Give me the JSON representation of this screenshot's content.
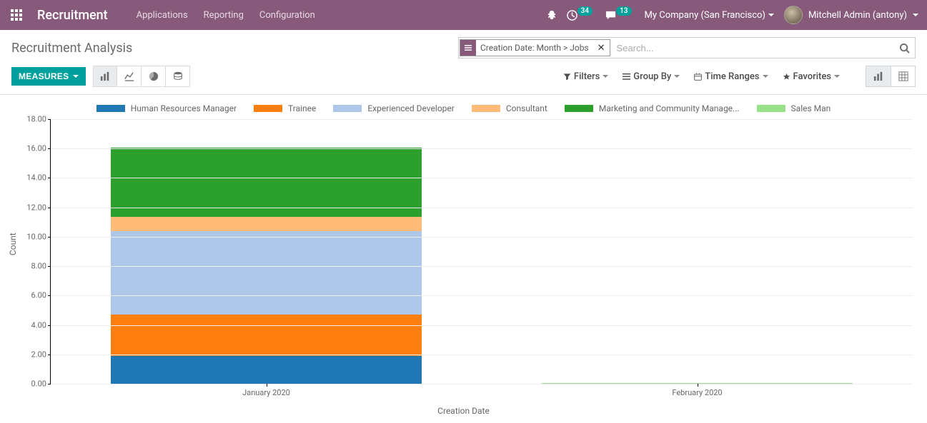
{
  "navbar": {
    "brand": "Recruitment",
    "menu": [
      "Applications",
      "Reporting",
      "Configuration"
    ],
    "activities_badge": "34",
    "messages_badge": "13",
    "company": "My Company (San Francisco)",
    "user": "Mitchell Admin (antony)"
  },
  "cp": {
    "breadcrumb": "Recruitment Analysis",
    "facet_label": "Creation Date: Month > Jobs",
    "search_placeholder": "Search...",
    "measures_label": "MEASURES",
    "filters_label": "Filters",
    "groupby_label": "Group By",
    "timeranges_label": "Time Ranges",
    "favorites_label": "Favorites"
  },
  "chart_data": {
    "type": "bar",
    "stacked": true,
    "xlabel": "Creation Date",
    "ylabel": "Count",
    "ylim": [
      0,
      18
    ],
    "y_ticks": [
      0,
      2,
      4,
      6,
      8,
      10,
      12,
      14,
      16,
      18
    ],
    "categories": [
      "January 2020",
      "February 2020"
    ],
    "series": [
      {
        "name": "Human Resources Manager",
        "color": "#1f77b4",
        "values": [
          2,
          0
        ]
      },
      {
        "name": "Trainee",
        "color": "#ff7f0e",
        "values": [
          3,
          0
        ]
      },
      {
        "name": "Experienced Developer",
        "color": "#aec7e8",
        "values": [
          6,
          0
        ]
      },
      {
        "name": "Consultant",
        "color": "#ffbb78",
        "values": [
          1,
          0
        ]
      },
      {
        "name": "Marketing and Community Manage...",
        "color": "#2ca02c",
        "values": [
          5,
          0
        ]
      },
      {
        "name": "Sales Man",
        "color": "#98df8a",
        "values": [
          0,
          1
        ]
      }
    ]
  }
}
